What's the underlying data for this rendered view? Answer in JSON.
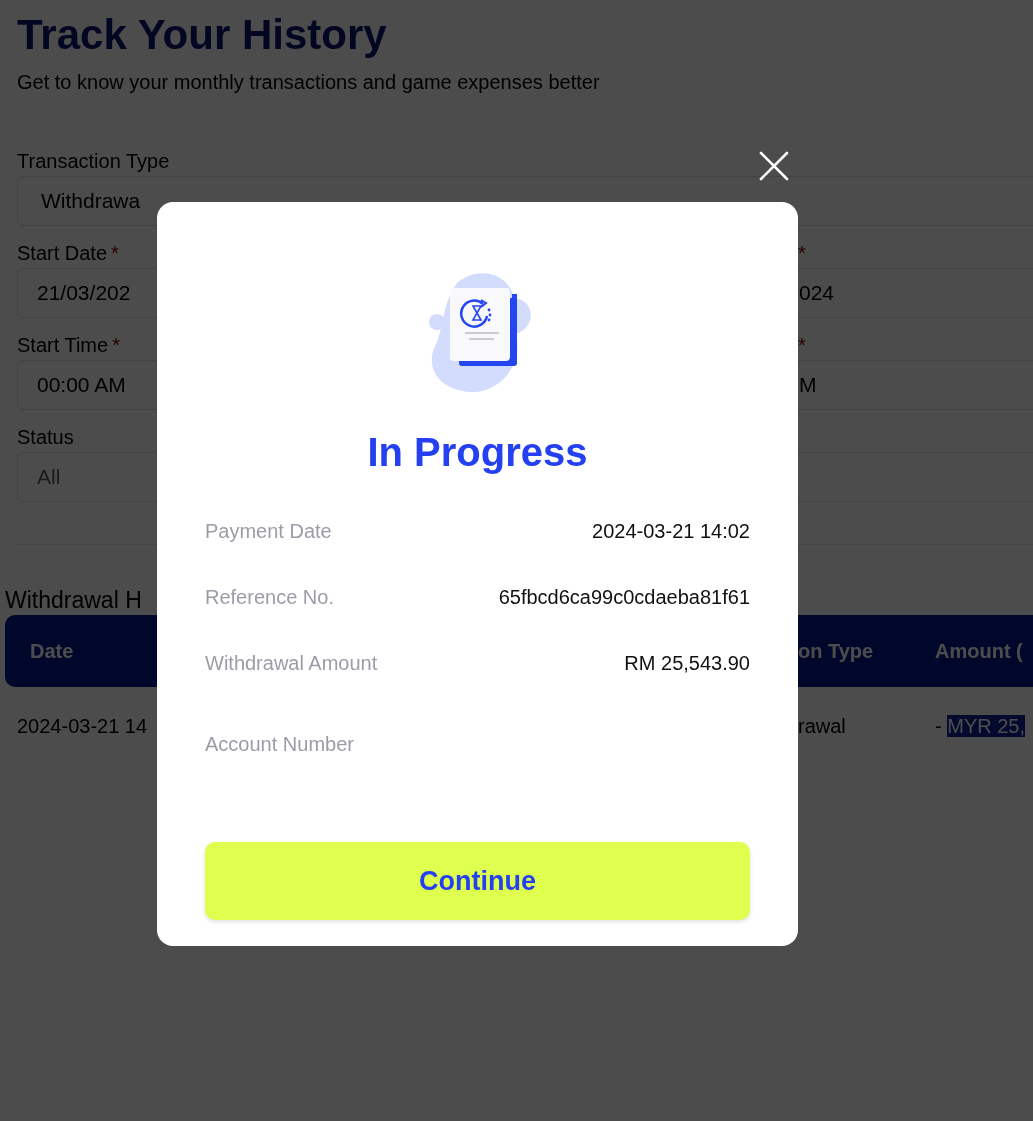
{
  "page": {
    "title": "Track Your History",
    "subtitle": "Get to know your monthly transactions and game expenses better"
  },
  "transaction_type": {
    "label": "Transaction Type",
    "value": "Withdrawa"
  },
  "filter_rows": [
    {
      "left": {
        "label": "Start Date",
        "required_mark": "*",
        "value": "21/03/202"
      },
      "right": {
        "required_mark": "*",
        "value": "024"
      }
    },
    {
      "left": {
        "label": "Start Time",
        "required_mark": "*",
        "value": "00:00 AM"
      },
      "right": {
        "required_mark": "*",
        "value": "M"
      }
    },
    {
      "left": {
        "label": "Status",
        "placeholder": "All"
      },
      "right": {}
    }
  ],
  "history": {
    "title": "Withdrawal H",
    "columns": [
      {
        "label": "Date"
      },
      {
        "label": "on Type"
      },
      {
        "label": "Amount ("
      }
    ],
    "rows": [
      {
        "date": "2024-03-21 14",
        "type": "rawal",
        "amount_sign": "-",
        "amount_selected": "MYR 25,"
      }
    ]
  },
  "modal": {
    "title": "In Progress",
    "details": [
      {
        "label": "Payment Date",
        "value": "2024-03-21 14:02"
      },
      {
        "label": "Reference No.",
        "value": "65fbcd6ca99c0cdaeba81f61"
      },
      {
        "label": "Withdrawal Amount",
        "value": "RM 25,543.90"
      },
      {
        "label": "Account Number"
      }
    ],
    "button": "Continue"
  }
}
